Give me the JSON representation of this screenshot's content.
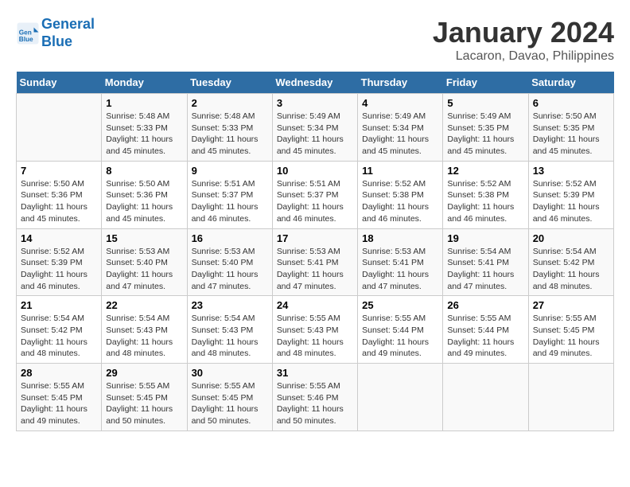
{
  "header": {
    "logo_line1": "General",
    "logo_line2": "Blue",
    "title": "January 2024",
    "subtitle": "Lacaron, Davao, Philippines"
  },
  "calendar": {
    "days_of_week": [
      "Sunday",
      "Monday",
      "Tuesday",
      "Wednesday",
      "Thursday",
      "Friday",
      "Saturday"
    ],
    "weeks": [
      [
        {
          "day": "",
          "info": ""
        },
        {
          "day": "1",
          "info": "Sunrise: 5:48 AM\nSunset: 5:33 PM\nDaylight: 11 hours\nand 45 minutes."
        },
        {
          "day": "2",
          "info": "Sunrise: 5:48 AM\nSunset: 5:33 PM\nDaylight: 11 hours\nand 45 minutes."
        },
        {
          "day": "3",
          "info": "Sunrise: 5:49 AM\nSunset: 5:34 PM\nDaylight: 11 hours\nand 45 minutes."
        },
        {
          "day": "4",
          "info": "Sunrise: 5:49 AM\nSunset: 5:34 PM\nDaylight: 11 hours\nand 45 minutes."
        },
        {
          "day": "5",
          "info": "Sunrise: 5:49 AM\nSunset: 5:35 PM\nDaylight: 11 hours\nand 45 minutes."
        },
        {
          "day": "6",
          "info": "Sunrise: 5:50 AM\nSunset: 5:35 PM\nDaylight: 11 hours\nand 45 minutes."
        }
      ],
      [
        {
          "day": "7",
          "info": "Sunrise: 5:50 AM\nSunset: 5:36 PM\nDaylight: 11 hours\nand 45 minutes."
        },
        {
          "day": "8",
          "info": "Sunrise: 5:50 AM\nSunset: 5:36 PM\nDaylight: 11 hours\nand 45 minutes."
        },
        {
          "day": "9",
          "info": "Sunrise: 5:51 AM\nSunset: 5:37 PM\nDaylight: 11 hours\nand 46 minutes."
        },
        {
          "day": "10",
          "info": "Sunrise: 5:51 AM\nSunset: 5:37 PM\nDaylight: 11 hours\nand 46 minutes."
        },
        {
          "day": "11",
          "info": "Sunrise: 5:52 AM\nSunset: 5:38 PM\nDaylight: 11 hours\nand 46 minutes."
        },
        {
          "day": "12",
          "info": "Sunrise: 5:52 AM\nSunset: 5:38 PM\nDaylight: 11 hours\nand 46 minutes."
        },
        {
          "day": "13",
          "info": "Sunrise: 5:52 AM\nSunset: 5:39 PM\nDaylight: 11 hours\nand 46 minutes."
        }
      ],
      [
        {
          "day": "14",
          "info": "Sunrise: 5:52 AM\nSunset: 5:39 PM\nDaylight: 11 hours\nand 46 minutes."
        },
        {
          "day": "15",
          "info": "Sunrise: 5:53 AM\nSunset: 5:40 PM\nDaylight: 11 hours\nand 47 minutes."
        },
        {
          "day": "16",
          "info": "Sunrise: 5:53 AM\nSunset: 5:40 PM\nDaylight: 11 hours\nand 47 minutes."
        },
        {
          "day": "17",
          "info": "Sunrise: 5:53 AM\nSunset: 5:41 PM\nDaylight: 11 hours\nand 47 minutes."
        },
        {
          "day": "18",
          "info": "Sunrise: 5:53 AM\nSunset: 5:41 PM\nDaylight: 11 hours\nand 47 minutes."
        },
        {
          "day": "19",
          "info": "Sunrise: 5:54 AM\nSunset: 5:41 PM\nDaylight: 11 hours\nand 47 minutes."
        },
        {
          "day": "20",
          "info": "Sunrise: 5:54 AM\nSunset: 5:42 PM\nDaylight: 11 hours\nand 48 minutes."
        }
      ],
      [
        {
          "day": "21",
          "info": "Sunrise: 5:54 AM\nSunset: 5:42 PM\nDaylight: 11 hours\nand 48 minutes."
        },
        {
          "day": "22",
          "info": "Sunrise: 5:54 AM\nSunset: 5:43 PM\nDaylight: 11 hours\nand 48 minutes."
        },
        {
          "day": "23",
          "info": "Sunrise: 5:54 AM\nSunset: 5:43 PM\nDaylight: 11 hours\nand 48 minutes."
        },
        {
          "day": "24",
          "info": "Sunrise: 5:55 AM\nSunset: 5:43 PM\nDaylight: 11 hours\nand 48 minutes."
        },
        {
          "day": "25",
          "info": "Sunrise: 5:55 AM\nSunset: 5:44 PM\nDaylight: 11 hours\nand 49 minutes."
        },
        {
          "day": "26",
          "info": "Sunrise: 5:55 AM\nSunset: 5:44 PM\nDaylight: 11 hours\nand 49 minutes."
        },
        {
          "day": "27",
          "info": "Sunrise: 5:55 AM\nSunset: 5:45 PM\nDaylight: 11 hours\nand 49 minutes."
        }
      ],
      [
        {
          "day": "28",
          "info": "Sunrise: 5:55 AM\nSunset: 5:45 PM\nDaylight: 11 hours\nand 49 minutes."
        },
        {
          "day": "29",
          "info": "Sunrise: 5:55 AM\nSunset: 5:45 PM\nDaylight: 11 hours\nand 50 minutes."
        },
        {
          "day": "30",
          "info": "Sunrise: 5:55 AM\nSunset: 5:45 PM\nDaylight: 11 hours\nand 50 minutes."
        },
        {
          "day": "31",
          "info": "Sunrise: 5:55 AM\nSunset: 5:46 PM\nDaylight: 11 hours\nand 50 minutes."
        },
        {
          "day": "",
          "info": ""
        },
        {
          "day": "",
          "info": ""
        },
        {
          "day": "",
          "info": ""
        }
      ]
    ]
  }
}
